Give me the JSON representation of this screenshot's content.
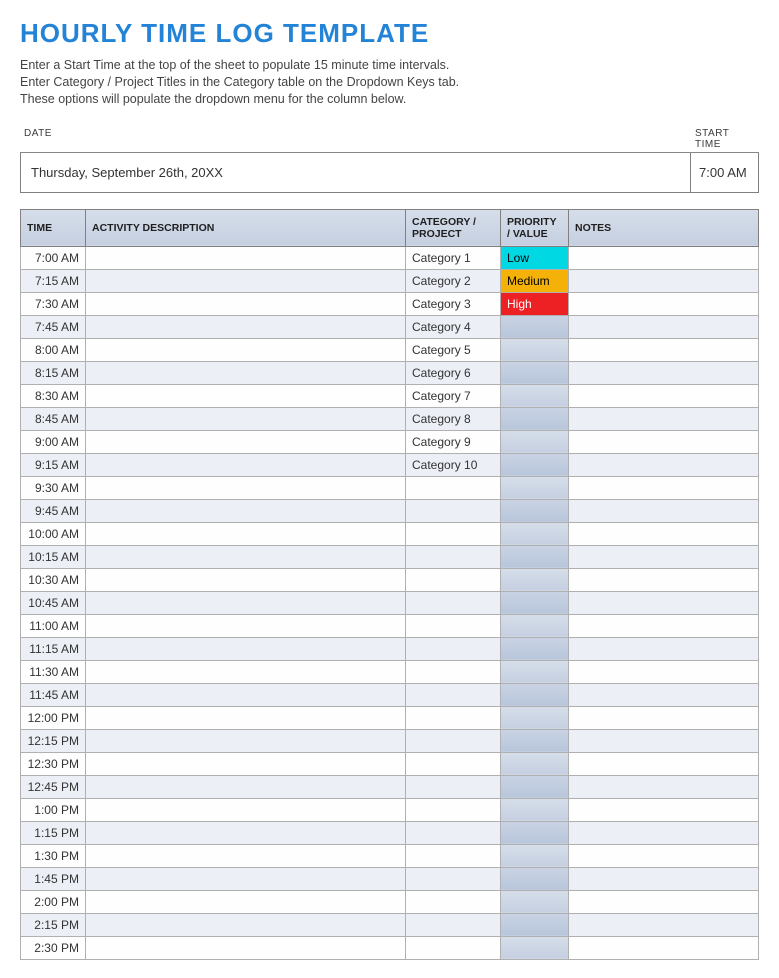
{
  "title": "HOURLY TIME LOG TEMPLATE",
  "instructions": [
    "Enter a Start Time at the top of the sheet to populate 15 minute time intervals.",
    "Enter Category / Project Titles in the Category table on the Dropdown Keys tab.",
    "These options will populate the dropdown menu for the column below."
  ],
  "header_labels": {
    "date": "DATE",
    "start_time": "START TIME"
  },
  "header_values": {
    "date": "Thursday, September 26th, 20XX",
    "start_time": "7:00 AM"
  },
  "columns": {
    "time": "TIME",
    "activity": "ACTIVITY DESCRIPTION",
    "category": "CATEGORY / PROJECT",
    "priority": "PRIORITY / VALUE",
    "notes": "NOTES"
  },
  "priority_styles": {
    "Low": "pri-low",
    "Medium": "pri-medium",
    "High": "pri-high"
  },
  "rows": [
    {
      "time": "7:00 AM",
      "activity": "",
      "category": "Category 1",
      "priority": "Low",
      "notes": ""
    },
    {
      "time": "7:15 AM",
      "activity": "",
      "category": "Category 2",
      "priority": "Medium",
      "notes": ""
    },
    {
      "time": "7:30 AM",
      "activity": "",
      "category": "Category 3",
      "priority": "High",
      "notes": ""
    },
    {
      "time": "7:45 AM",
      "activity": "",
      "category": "Category 4",
      "priority": "",
      "notes": ""
    },
    {
      "time": "8:00 AM",
      "activity": "",
      "category": "Category 5",
      "priority": "",
      "notes": ""
    },
    {
      "time": "8:15 AM",
      "activity": "",
      "category": "Category 6",
      "priority": "",
      "notes": ""
    },
    {
      "time": "8:30 AM",
      "activity": "",
      "category": "Category 7",
      "priority": "",
      "notes": ""
    },
    {
      "time": "8:45 AM",
      "activity": "",
      "category": "Category 8",
      "priority": "",
      "notes": ""
    },
    {
      "time": "9:00 AM",
      "activity": "",
      "category": "Category 9",
      "priority": "",
      "notes": ""
    },
    {
      "time": "9:15 AM",
      "activity": "",
      "category": "Category 10",
      "priority": "",
      "notes": ""
    },
    {
      "time": "9:30 AM",
      "activity": "",
      "category": "",
      "priority": "",
      "notes": ""
    },
    {
      "time": "9:45 AM",
      "activity": "",
      "category": "",
      "priority": "",
      "notes": ""
    },
    {
      "time": "10:00 AM",
      "activity": "",
      "category": "",
      "priority": "",
      "notes": ""
    },
    {
      "time": "10:15 AM",
      "activity": "",
      "category": "",
      "priority": "",
      "notes": ""
    },
    {
      "time": "10:30 AM",
      "activity": "",
      "category": "",
      "priority": "",
      "notes": ""
    },
    {
      "time": "10:45 AM",
      "activity": "",
      "category": "",
      "priority": "",
      "notes": ""
    },
    {
      "time": "11:00 AM",
      "activity": "",
      "category": "",
      "priority": "",
      "notes": ""
    },
    {
      "time": "11:15 AM",
      "activity": "",
      "category": "",
      "priority": "",
      "notes": ""
    },
    {
      "time": "11:30 AM",
      "activity": "",
      "category": "",
      "priority": "",
      "notes": ""
    },
    {
      "time": "11:45 AM",
      "activity": "",
      "category": "",
      "priority": "",
      "notes": ""
    },
    {
      "time": "12:00 PM",
      "activity": "",
      "category": "",
      "priority": "",
      "notes": ""
    },
    {
      "time": "12:15 PM",
      "activity": "",
      "category": "",
      "priority": "",
      "notes": ""
    },
    {
      "time": "12:30 PM",
      "activity": "",
      "category": "",
      "priority": "",
      "notes": ""
    },
    {
      "time": "12:45 PM",
      "activity": "",
      "category": "",
      "priority": "",
      "notes": ""
    },
    {
      "time": "1:00 PM",
      "activity": "",
      "category": "",
      "priority": "",
      "notes": ""
    },
    {
      "time": "1:15 PM",
      "activity": "",
      "category": "",
      "priority": "",
      "notes": ""
    },
    {
      "time": "1:30 PM",
      "activity": "",
      "category": "",
      "priority": "",
      "notes": ""
    },
    {
      "time": "1:45 PM",
      "activity": "",
      "category": "",
      "priority": "",
      "notes": ""
    },
    {
      "time": "2:00 PM",
      "activity": "",
      "category": "",
      "priority": "",
      "notes": ""
    },
    {
      "time": "2:15 PM",
      "activity": "",
      "category": "",
      "priority": "",
      "notes": ""
    },
    {
      "time": "2:30 PM",
      "activity": "",
      "category": "",
      "priority": "",
      "notes": ""
    }
  ]
}
